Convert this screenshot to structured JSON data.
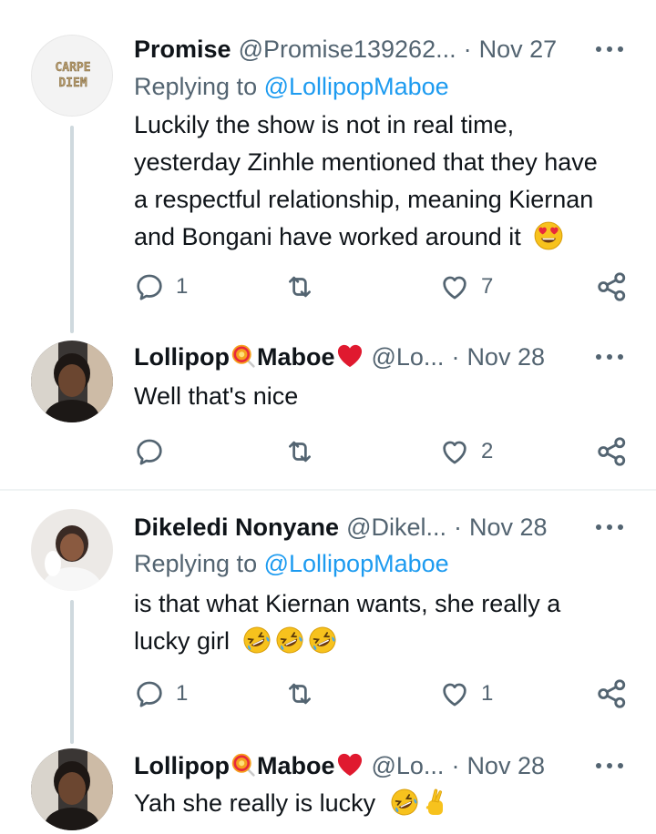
{
  "colors": {
    "text": "#0f1419",
    "secondary": "#536471",
    "link": "#1d9bf0",
    "thread_line": "#cfd9de"
  },
  "tweets": [
    {
      "name": "Promise",
      "handle": "@Promise139262...",
      "date": "Nov 27",
      "replying_prefix": "Replying to ",
      "replying_to": "@LollipopMaboe",
      "lines": [
        "Luckily the show is not in real time,",
        "yesterday Zinhle mentioned that they have",
        "a respectful relationship, meaning Kiernan",
        "and Bongani have worked around it"
      ],
      "emoji": "heart-eyes",
      "reply_count": "1",
      "like_count": "7",
      "avatar_text": [
        "CARPE",
        "DIEM"
      ]
    },
    {
      "name_a": "Lollipop",
      "name_b": "Maboe",
      "handle": "@Lo...",
      "date": "Nov 28",
      "text": "Well that's nice",
      "like_count": "2"
    },
    {
      "name": "Dikeledi Nonyane",
      "handle": "@Dikel...",
      "date": "Nov 28",
      "replying_prefix": "Replying to ",
      "replying_to": "@LollipopMaboe",
      "lines": [
        "is that what Kiernan wants, she really a",
        "lucky girl"
      ],
      "emoji": "rofl x3",
      "reply_count": "1",
      "like_count": "1"
    },
    {
      "name_a": "Lollipop",
      "name_b": "Maboe",
      "handle": "@Lo...",
      "date": "Nov 28",
      "text": "Yah she really is lucky",
      "emoji": "rofl, crossed-fingers"
    }
  ],
  "date_separator": "·",
  "icons": [
    "reply-icon",
    "retweet-icon",
    "like-icon",
    "share-icon",
    "more-icon",
    "lollipop-emoji",
    "red-heart-emoji",
    "heart-eyes-emoji",
    "rofl-emoji",
    "crossed-fingers-emoji"
  ]
}
